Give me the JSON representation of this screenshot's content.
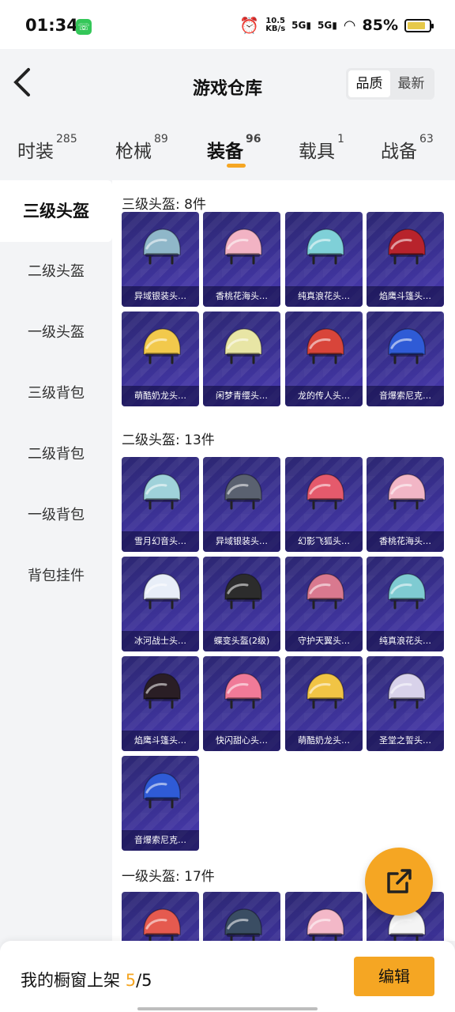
{
  "status_bar": {
    "time": "01:34",
    "badge_icon": "phone-call-icon",
    "speed_value": "10.5",
    "speed_unit": "KB/s",
    "sig1": "5G",
    "sig2": "5G",
    "battery": "85%"
  },
  "header": {
    "back_icon": "back-arrow-icon",
    "title": "游戏仓库",
    "sort_quality": "品质",
    "sort_latest": "最新"
  },
  "tabs": [
    {
      "label": "时装",
      "count": "285"
    },
    {
      "label": "枪械",
      "count": "89"
    },
    {
      "label": "装备",
      "count": "96"
    },
    {
      "label": "载具",
      "count": "1"
    },
    {
      "label": "战备",
      "count": "63"
    }
  ],
  "accent": "#f5a623",
  "sidebar": {
    "items": [
      "三级头盔",
      "二级头盔",
      "一级头盔",
      "三级背包",
      "二级背包",
      "一级背包",
      "背包挂件"
    ]
  },
  "sections": [
    {
      "title": "三级头盔: 8件",
      "items": [
        {
          "name": "异域银装头…",
          "color": "#8fb7c9"
        },
        {
          "name": "香桃花海头…",
          "color": "#f2b3c4"
        },
        {
          "name": "纯真浪花头…",
          "color": "#7fd0d8"
        },
        {
          "name": "焰鹰斗篷头…",
          "color": "#b8232c"
        },
        {
          "name": "萌酷奶龙头…",
          "color": "#f2c94c"
        },
        {
          "name": "闲梦青缨头…",
          "color": "#e8e5a5"
        },
        {
          "name": "龙的传人头…",
          "color": "#d8453a"
        },
        {
          "name": "音爆索尼克…",
          "color": "#2f5bd6"
        }
      ]
    },
    {
      "title": "二级头盔: 13件",
      "items": [
        {
          "name": "雪月幻音头…",
          "color": "#9fd2da"
        },
        {
          "name": "异域银装头…",
          "color": "#5a6170"
        },
        {
          "name": "幻影飞狐头…",
          "color": "#e55a6c"
        },
        {
          "name": "香桃花海头…",
          "color": "#f2b6c6"
        },
        {
          "name": "冰河战士头…",
          "color": "#e8eef8"
        },
        {
          "name": "蝶变头盔(2级)",
          "color": "#2c2c2c"
        },
        {
          "name": "守护天翼头…",
          "color": "#d9798f"
        },
        {
          "name": "纯真浪花头…",
          "color": "#7fcbd2"
        },
        {
          "name": "焰鹰斗篷头…",
          "color": "#2a1e25"
        },
        {
          "name": "快闪甜心头…",
          "color": "#f07a98"
        },
        {
          "name": "萌酷奶龙头…",
          "color": "#f1c445"
        },
        {
          "name": "圣堂之誓头…",
          "color": "#d8d2ea"
        },
        {
          "name": "音爆索尼克…",
          "color": "#2f5bd6"
        }
      ]
    },
    {
      "title": "一级头盔: 17件",
      "items": [
        {
          "name": "",
          "color": "#e55a4f"
        },
        {
          "name": "",
          "color": "#3a4d63"
        },
        {
          "name": "",
          "color": "#f3b8c8"
        },
        {
          "name": "",
          "color": "#f4f4f4"
        }
      ]
    }
  ],
  "bottom": {
    "label": "我的橱窗上架 ",
    "current": "5",
    "total": "/5",
    "edit": "编辑"
  },
  "fab_icon": "share-external-icon"
}
